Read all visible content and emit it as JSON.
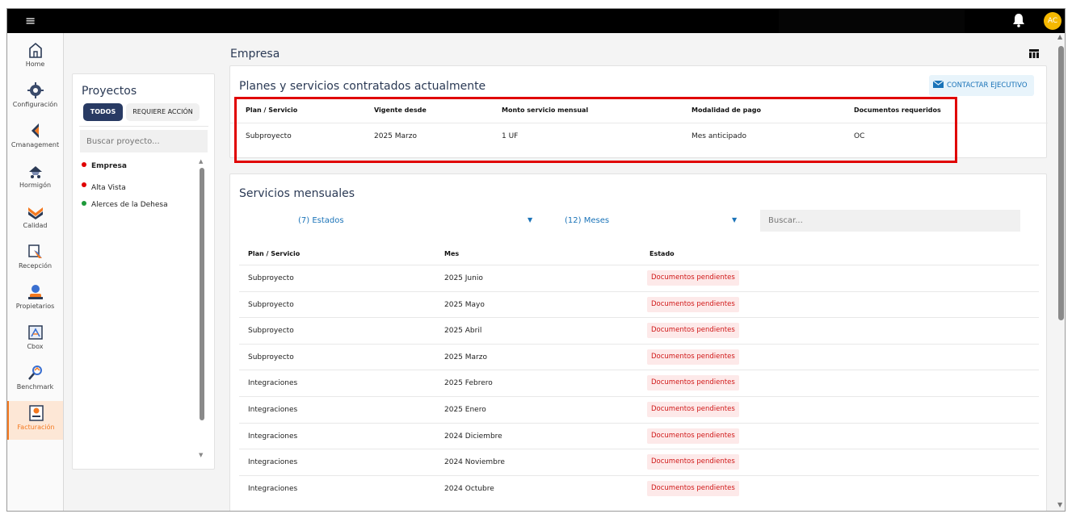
{
  "topbar": {
    "menu_glyph": "≡",
    "avatar_initials": "AC"
  },
  "nav": [
    {
      "label": "Home",
      "icon": "home-icon"
    },
    {
      "label": "Configuración",
      "icon": "gear-icon"
    },
    {
      "label": "Cmanagement",
      "icon": "flag-icon"
    },
    {
      "label": "Hormigón",
      "icon": "truck-icon"
    },
    {
      "label": "Calidad",
      "icon": "check-icon"
    },
    {
      "label": "Recepción",
      "icon": "reception-icon"
    },
    {
      "label": "Propietarios",
      "icon": "owner-icon"
    },
    {
      "label": "Cbox",
      "icon": "cbox-icon"
    },
    {
      "label": "Benchmark",
      "icon": "benchmark-icon"
    },
    {
      "label": "Facturación",
      "icon": "billing-icon",
      "active": true
    }
  ],
  "projects": {
    "title": "Proyectos",
    "btn_all": "TODOS",
    "btn_action": "REQUIERE ACCIÓN",
    "search_placeholder": "Buscar proyecto...",
    "items": [
      {
        "label": "Empresa",
        "color": "#e00000",
        "bold": true
      },
      {
        "label": "Alta Vista",
        "color": "#e00000",
        "bold": false
      },
      {
        "label": "Alerces de la Dehesa",
        "color": "#1e9a3a",
        "bold": false
      }
    ]
  },
  "main": {
    "title": "Empresa"
  },
  "plans": {
    "title": "Planes y servicios contratados actualmente",
    "contact_label": "CONTACTAR EJECUTIVO",
    "headers": [
      "Plan / Servicio",
      "Vigente desde",
      "Monto servicio mensual",
      "Modalidad de pago",
      "Documentos requeridos"
    ],
    "row": [
      "Subproyecto",
      "2025 Marzo",
      "1 UF",
      "Mes anticipado",
      "OC"
    ]
  },
  "monthly": {
    "title": "Servicios mensuales",
    "filter_states": "(7) Estados",
    "filter_months": "(12) Meses",
    "search_placeholder": "Buscar...",
    "headers": [
      "Plan / Servicio",
      "Mes",
      "Estado"
    ],
    "rows": [
      {
        "plan": "Subproyecto",
        "month": "2025 Junio",
        "status": "Documentos pendientes"
      },
      {
        "plan": "Subproyecto",
        "month": "2025 Mayo",
        "status": "Documentos pendientes"
      },
      {
        "plan": "Subproyecto",
        "month": "2025 Abril",
        "status": "Documentos pendientes"
      },
      {
        "plan": "Subproyecto",
        "month": "2025 Marzo",
        "status": "Documentos pendientes"
      },
      {
        "plan": "Integraciones",
        "month": "2025 Febrero",
        "status": "Documentos pendientes"
      },
      {
        "plan": "Integraciones",
        "month": "2025 Enero",
        "status": "Documentos pendientes"
      },
      {
        "plan": "Integraciones",
        "month": "2024 Diciembre",
        "status": "Documentos pendientes"
      },
      {
        "plan": "Integraciones",
        "month": "2024 Noviembre",
        "status": "Documentos pendientes"
      },
      {
        "plan": "Integraciones",
        "month": "2024 Octubre",
        "status": "Documentos pendientes"
      }
    ]
  },
  "colors": {
    "accent": "#283a63",
    "highlight": "#e00000",
    "link": "#1a73b8",
    "active_nav": "#f47920",
    "status_bg": "#fde9e9",
    "status_text": "#d01818"
  }
}
